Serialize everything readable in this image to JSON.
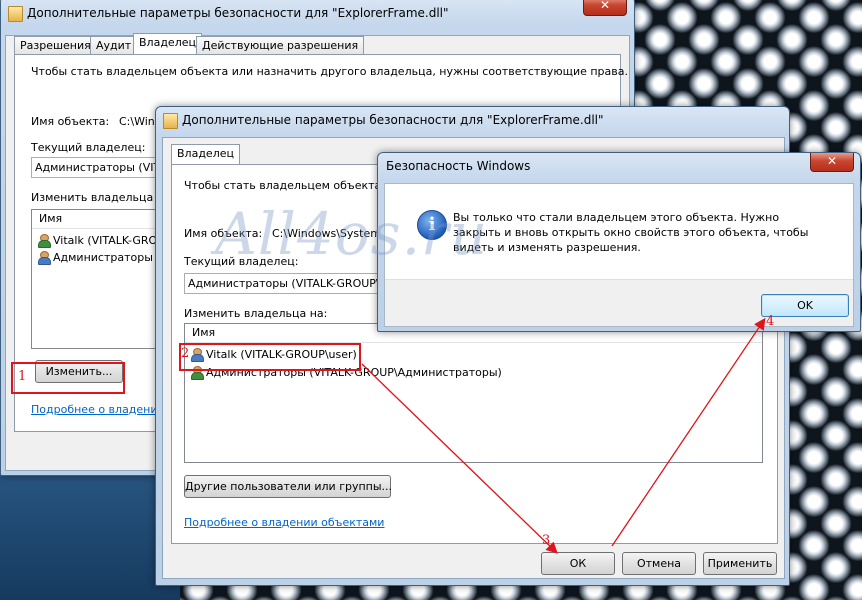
{
  "window_back": {
    "title": "Дополнительные параметры безопасности  для \"ExplorerFrame.dll\"",
    "tabs": [
      "Разрешения",
      "Аудит",
      "Владелец",
      "Действующие разрешения"
    ],
    "info_text": "Чтобы стать владельцем объекта или назначить другого владельца, нужны соответствующие права.",
    "object_name_label": "Имя объекта:",
    "object_name_value": "C:\\Windo",
    "current_owner_label": "Текущий владелец:",
    "current_owner_value": "Администраторы (VITALK-GROUP",
    "change_owner_label": "Изменить владельца на:",
    "list_header": "Имя",
    "list_items": [
      "Vitalk (VITALK-GROUP",
      "Администраторы (VIT"
    ],
    "change_button": "Изменить...",
    "link": "Подробнее о владении о"
  },
  "window_front": {
    "title": "Дополнительные параметры безопасности  для \"ExplorerFrame.dll\"",
    "tab": "Владелец",
    "info_text": "Чтобы стать владельцем объекта или",
    "object_name_label": "Имя объекта:",
    "object_name_value": "C:\\Windows\\System32",
    "current_owner_label": "Текущий владелец:",
    "current_owner_value": "Администраторы (VITALK-GROUP\\Адм",
    "change_owner_label": "Изменить владельца на:",
    "list_header": "Имя",
    "list_items": [
      "Vitalk (VITALK-GROUP\\user)",
      "Администраторы (VITALK-GROUP\\Администраторы)"
    ],
    "other_users_button": "Другие пользователи или группы...",
    "link": "Подробнее о владении объектами",
    "ok_button": "ОК",
    "cancel_button": "Отмена",
    "apply_button": "Применить"
  },
  "dialog": {
    "title": "Безопасность Windows",
    "message": "Вы только что стали владельцем этого объекта. Нужно закрыть и вновь открыть окно свойств этого объекта, чтобы видеть и изменять разрешения.",
    "ok_button": "OK"
  },
  "annotations": {
    "step1": "1",
    "step2": "2",
    "step3": "3",
    "step4": "4",
    "watermark": "All4os.ru",
    "color": "#e0141a"
  },
  "icons": [
    "folder-icon",
    "close-icon",
    "user-icon",
    "group-icon",
    "info-icon"
  ]
}
